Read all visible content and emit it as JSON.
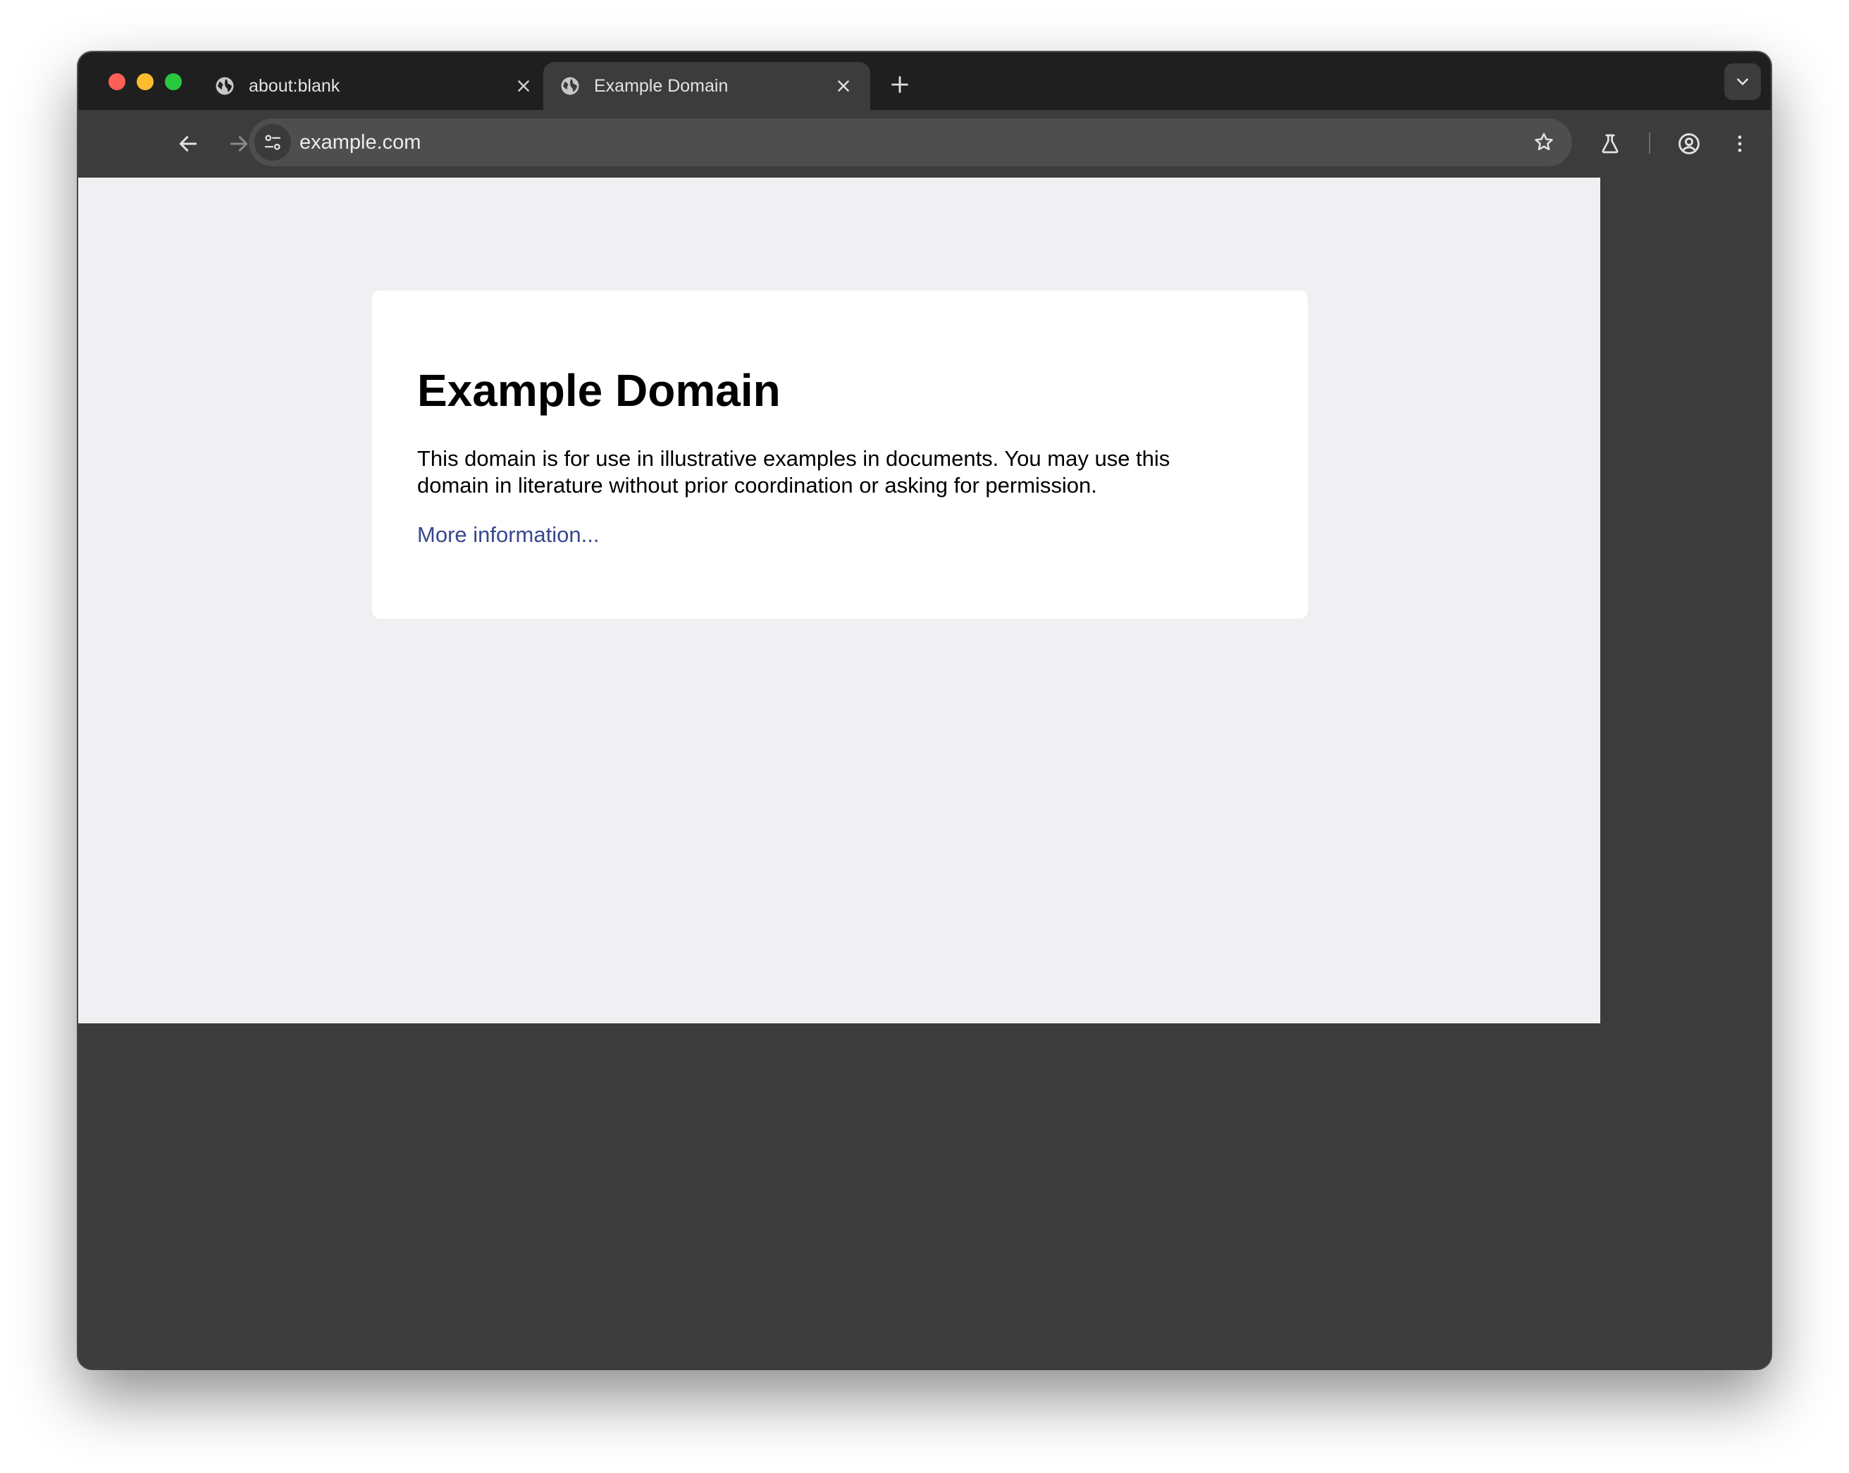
{
  "colors": {
    "tab_strip_bg": "#1f1f1f",
    "toolbar_bg": "#3c3c3c",
    "omnibox_bg": "#4e4e4e",
    "page_bg": "#f0f0f2",
    "card_bg": "#ffffff",
    "link": "#38488f",
    "close_light": "#fe5f57",
    "minimize_light": "#febc2e",
    "maximize_light": "#28c840"
  },
  "tabs": [
    {
      "title": "about:blank",
      "active": false,
      "icon": "globe-icon"
    },
    {
      "title": "Example Domain",
      "active": true,
      "icon": "globe-icon"
    }
  ],
  "toolbar": {
    "url": "example.com",
    "icons": [
      "back-arrow-icon",
      "forward-arrow-icon",
      "reload-icon",
      "site-settings-icon",
      "bookmark-star-icon",
      "labs-flask-icon",
      "profile-icon",
      "menu-kebab-icon"
    ]
  },
  "page": {
    "heading": "Example Domain",
    "paragraph": "This domain is for use in illustrative examples in documents. You may use this domain in literature without prior coordination or asking for permission.",
    "link_text": "More information..."
  }
}
